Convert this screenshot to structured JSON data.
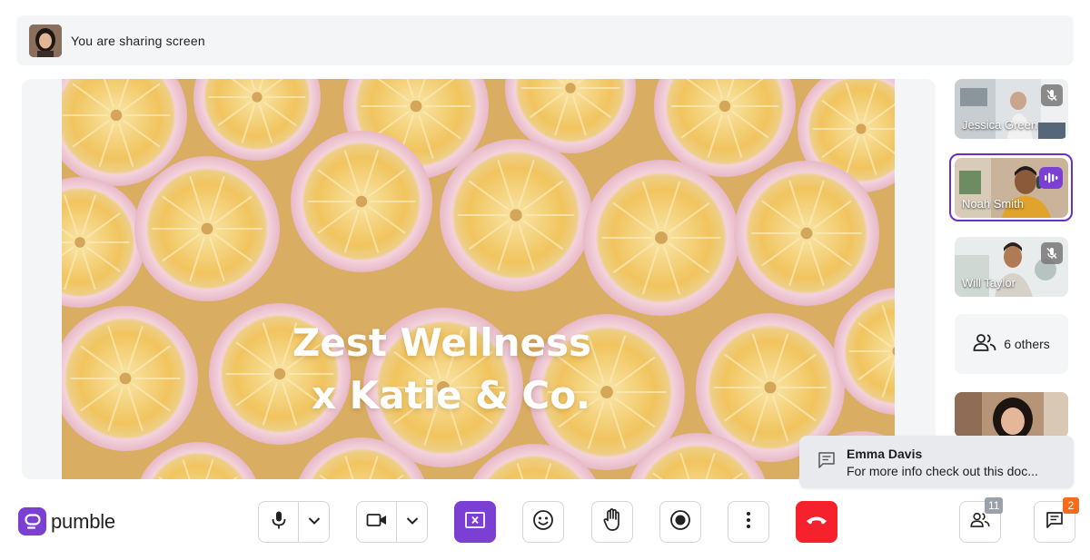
{
  "banner": {
    "text": "You are sharing screen"
  },
  "slide": {
    "title_line1": "Zest Wellness",
    "title_line2": "x Katie & Co."
  },
  "participants": [
    {
      "name": "Jessica Green",
      "muted": true
    },
    {
      "name": "Noah Smith",
      "speaking": true
    },
    {
      "name": "Will Taylor",
      "muted": true
    }
  ],
  "others": {
    "label": "6 others"
  },
  "toast": {
    "sender": "Emma Davis",
    "message": "For more info check out this doc..."
  },
  "brand": {
    "name": "pumble",
    "color": "#7b3fd3"
  },
  "controls": {
    "leave_color": "#f5222d",
    "share_color": "#7b3fd3"
  },
  "counts": {
    "participants": "11",
    "chat_unread": "2"
  },
  "icons": [
    "mic-icon",
    "chevron-down-icon",
    "camera-icon",
    "stop-share-icon",
    "emoji-icon",
    "raise-hand-icon",
    "record-icon",
    "more-icon",
    "hang-up-icon",
    "people-icon",
    "chat-icon",
    "mic-off-icon",
    "audio-wave-icon",
    "comment-icon"
  ]
}
